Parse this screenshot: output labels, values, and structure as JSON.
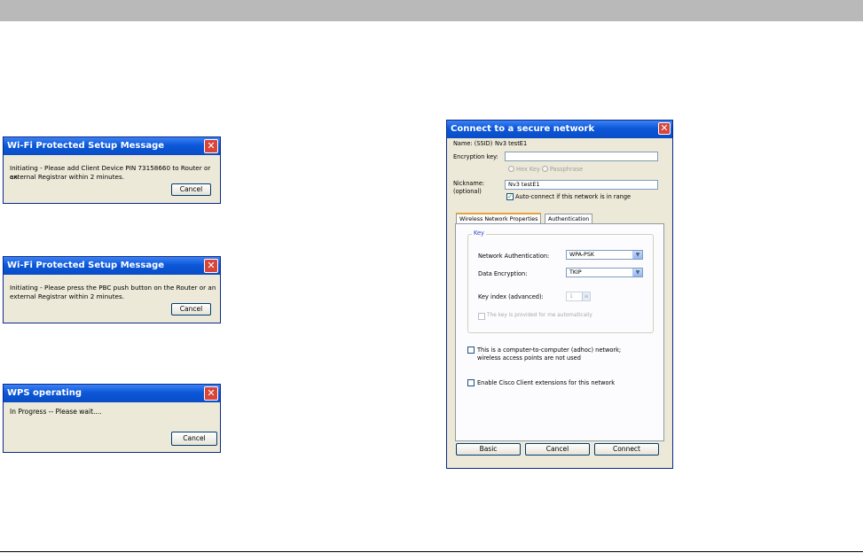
{
  "dialog1": {
    "title": "Wi-Fi Protected Setup Message",
    "message_line1": "Initiating - Please add Client Device PIN  73158660  to Router or an",
    "message_line2": "external Registrar within 2 minutes.",
    "cancel_label": "Cancel"
  },
  "dialog2": {
    "title": "Wi-Fi Protected Setup Message",
    "message_line1": "Initiating - Please press the PBC push button on the Router or an",
    "message_line2": "external Registrar within 2 minutes.",
    "cancel_label": "Cancel"
  },
  "dialog3": {
    "title": "WPS operating",
    "message": "In Progress -- Please wait....",
    "cancel_label": "Cancel"
  },
  "connect": {
    "title": "Connect to a secure network",
    "name_label": "Name:  (SSID)",
    "name_value": "Nv3 testE1",
    "encryption_label": "Encryption key:",
    "encryption_value": "",
    "hex_key_label": "Hex Key",
    "passphrase_label": "Passphrase",
    "nickname_label_1": "Nickname:",
    "nickname_label_2": "(optional)",
    "nickname_value": "Nv3 testE1",
    "autoconnect_label": "Auto-connect if this network is in range",
    "autoconnect_checked": true,
    "tabs": [
      "Wireless Network Properties",
      "Authentication"
    ],
    "key_group_label": "Key",
    "network_auth_label": "Network Authentication:",
    "network_auth_value": "WPA-PSK",
    "data_encryption_label": "Data Encryption:",
    "data_encryption_value": "TKIP",
    "key_index_label": "Key index (advanced):",
    "key_index_value": "1",
    "key_auto_label": "The key is provided for me automatically",
    "adhoc_label_1": "This is a computer-to-computer (adhoc) network;",
    "adhoc_label_2": "wireless access points are not used",
    "cisco_label": "Enable Cisco Client extensions for this network",
    "basic_label": "Basic",
    "cancel_label": "Cancel",
    "connect_label": "Connect"
  }
}
